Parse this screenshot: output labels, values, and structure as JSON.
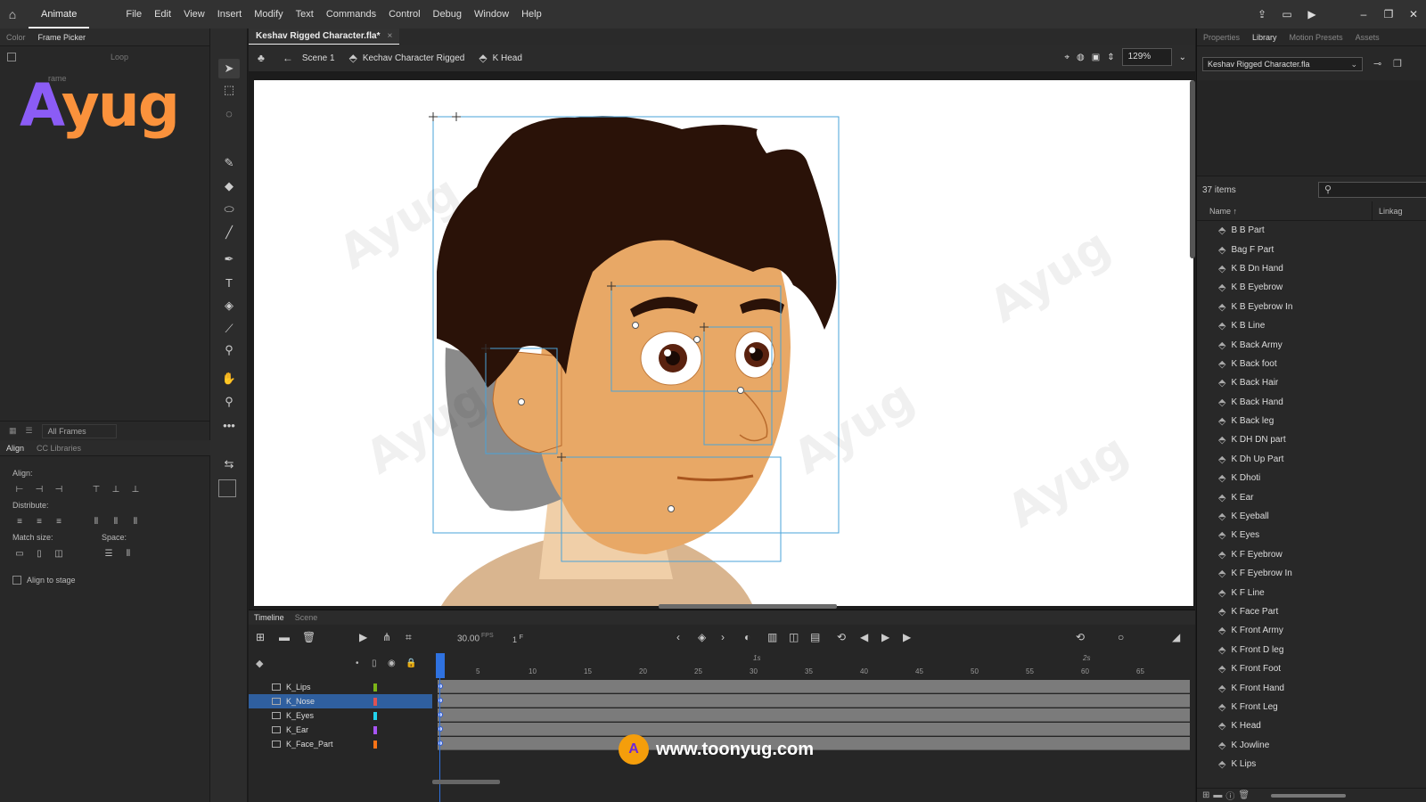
{
  "menubar": {
    "app_name": "Animate",
    "menus": [
      "File",
      "Edit",
      "View",
      "Insert",
      "Modify",
      "Text",
      "Commands",
      "Control",
      "Debug",
      "Window",
      "Help"
    ]
  },
  "left_panel": {
    "tabs": [
      "Color",
      "Frame Picker"
    ],
    "loop_label": "Loop",
    "frame_placeholder": "rame",
    "logo_text_a": "A",
    "logo_text_yug": "yug",
    "all_frames": "All Frames",
    "align_tabs": [
      "Align",
      "CC Libraries"
    ],
    "align_label": "Align:",
    "distribute_label": "Distribute:",
    "match_size_label": "Match size:",
    "space_label": "Space:",
    "align_to_stage": "Align to stage"
  },
  "document": {
    "tab_title": "Keshav Rigged Character.fla*",
    "breadcrumbs": [
      "Scene 1",
      "Kechav Character Rigged",
      "K Head"
    ],
    "zoom": "129%"
  },
  "timeline": {
    "tabs": [
      "Timeline",
      "Scene"
    ],
    "fps": "30.00",
    "fps_unit": "FPS",
    "current_frame": "1",
    "frame_unit": "F",
    "ruler_ticks": [
      "5",
      "10",
      "15",
      "20",
      "25",
      "30",
      "35",
      "40",
      "45",
      "50",
      "55",
      "60",
      "65"
    ],
    "seconds": [
      "1s",
      "2s"
    ],
    "layers": [
      {
        "name": "K_Lips",
        "color": "#7cb518",
        "selected": false
      },
      {
        "name": "K_Nose",
        "color": "#e05252",
        "selected": true
      },
      {
        "name": "K_Eyes",
        "color": "#22d3ee",
        "selected": false
      },
      {
        "name": "K_Ear",
        "color": "#a855f7",
        "selected": false
      },
      {
        "name": "K_Face_Part",
        "color": "#f97316",
        "selected": false
      }
    ]
  },
  "watermark": {
    "url": "www.toonyug.com",
    "badge": "A"
  },
  "library": {
    "tabs": [
      "Properties",
      "Library",
      "Motion Presets",
      "Assets"
    ],
    "file": "Keshav Rigged Character.fla",
    "item_count": "37 items",
    "col_name": "Name",
    "col_linkage": "Linkag",
    "items": [
      "B B Part",
      "Bag F Part",
      "K B Dn Hand",
      "K B Eyebrow",
      "K B Eyebrow In",
      "K B Line",
      "K Back Army",
      "K Back foot",
      "K Back Hair",
      "K Back Hand",
      "K Back leg",
      "K DH DN part",
      "K Dh Up Part",
      "K Dhoti",
      "K Ear",
      "K Eyeball",
      "K Eyes",
      "K F Eyebrow",
      "K F Eyebrow In",
      "K F Line",
      "K Face Part",
      "K Front Army",
      "K Front D leg",
      "K Front Foot",
      "K Front Hand",
      "K Front Leg",
      "K Head",
      "K Jowline",
      "K Lips"
    ]
  },
  "colors": {
    "skin": "#e8a866",
    "hair": "#2a1208",
    "selection": "#4aa3d8",
    "accent": "#2f72e0"
  }
}
